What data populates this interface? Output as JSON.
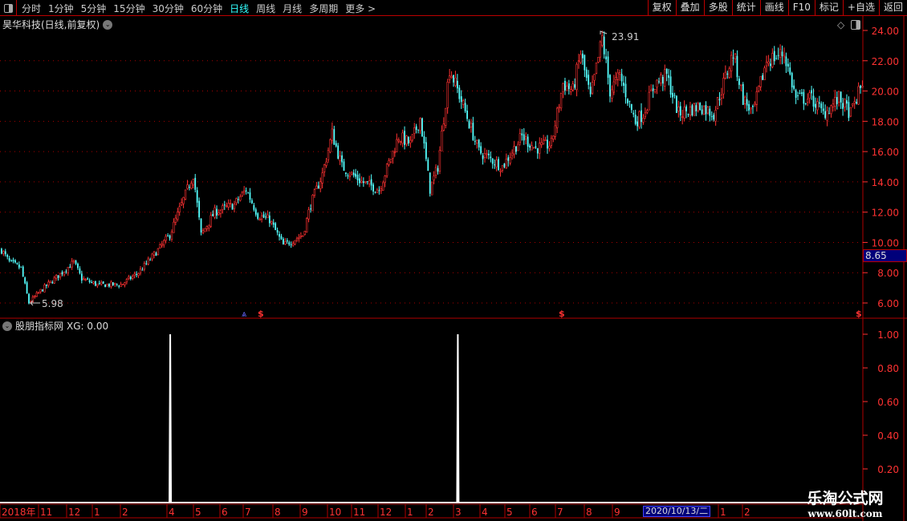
{
  "toolbar": {
    "periods": [
      "分时",
      "1分钟",
      "5分钟",
      "15分钟",
      "30分钟",
      "60分钟",
      "日线",
      "周线",
      "月线",
      "多周期",
      "更多 >"
    ],
    "active_period": "日线",
    "buttons": [
      "复权",
      "叠加",
      "多股",
      "统计",
      "画线",
      "F10",
      "标记",
      "+自选",
      "返回"
    ]
  },
  "header": {
    "title": "昊华科技(日线,前复权)"
  },
  "indicator": {
    "name": "股朋指标网",
    "value_label": "XG: 0.00"
  },
  "watermark": {
    "name": "乐淘公式网",
    "url": "www.60lt.com"
  },
  "cursor_date": "2020/10/13/二",
  "current_price": "8.65",
  "colors": {
    "up": "#ff3232",
    "down": "#54ffff",
    "axis": "#ff3232",
    "frame": "#b00000",
    "xg_line": "#ffffff",
    "highlight": "#00007a"
  },
  "chart_data": [
    {
      "type": "candlestick",
      "title": "昊华科技(日线,前复权)",
      "y_ticks": [
        "24.00",
        "22.00",
        "20.00",
        "18.00",
        "16.00",
        "14.00",
        "12.00",
        "10.00",
        "8.00",
        "6.00"
      ],
      "ylim": [
        6,
        24
      ],
      "grid": true,
      "x_ticks": [
        "2018年",
        "11",
        "12",
        "1",
        "2",
        "4",
        "5",
        "6",
        "7",
        "8",
        "9",
        "10",
        "11",
        "12",
        "1",
        "2",
        "3",
        "4",
        "5",
        "6",
        "7",
        "8",
        "9",
        "2020/10/13/二",
        "1",
        "2"
      ],
      "approx_price_path": [
        [
          0,
          9.5
        ],
        [
          4,
          8.7
        ],
        [
          10,
          8.3
        ],
        [
          14,
          6.0
        ],
        [
          20,
          6.8
        ],
        [
          29,
          7.8
        ],
        [
          37,
          8.7
        ],
        [
          41,
          7.6
        ],
        [
          49,
          7.2
        ],
        [
          61,
          7.2
        ],
        [
          70,
          8.0
        ],
        [
          80,
          9.5
        ],
        [
          86,
          10.5
        ],
        [
          92,
          12.5
        ],
        [
          98,
          14.5
        ],
        [
          102,
          10.5
        ],
        [
          109,
          12.0
        ],
        [
          119,
          12.5
        ],
        [
          125,
          13.5
        ],
        [
          131,
          11.8
        ],
        [
          137,
          11.5
        ],
        [
          144,
          9.8
        ],
        [
          154,
          10.5
        ],
        [
          158,
          12.5
        ],
        [
          164,
          14.5
        ],
        [
          169,
          17.2
        ],
        [
          174,
          15
        ],
        [
          184,
          14
        ],
        [
          193,
          13.5
        ],
        [
          203,
          17
        ],
        [
          209,
          16.5
        ],
        [
          214,
          18.2
        ],
        [
          219,
          13.5
        ],
        [
          223,
          15
        ],
        [
          229,
          21.5
        ],
        [
          236,
          19
        ],
        [
          244,
          16
        ],
        [
          256,
          15
        ],
        [
          266,
          17
        ],
        [
          273,
          16.2
        ],
        [
          281,
          16.5
        ],
        [
          287,
          20.5
        ],
        [
          292,
          20
        ],
        [
          296,
          22.5
        ],
        [
          301,
          19.5
        ],
        [
          307,
          23.5
        ],
        [
          311,
          20
        ],
        [
          316,
          21
        ],
        [
          324,
          18
        ],
        [
          328,
          18.5
        ],
        [
          334,
          20.5
        ],
        [
          340,
          21
        ],
        [
          346,
          18.5
        ],
        [
          357,
          19
        ],
        [
          364,
          18.5
        ],
        [
          374,
          22.5
        ],
        [
          379,
          19.5
        ],
        [
          384,
          18.5
        ],
        [
          391,
          22
        ],
        [
          400,
          22.5
        ],
        [
          406,
          19.5
        ],
        [
          414,
          19.5
        ],
        [
          420,
          18.5
        ],
        [
          428,
          19.5
        ],
        [
          434,
          18.5
        ],
        [
          440,
          20.5
        ]
      ],
      "annotations": [
        {
          "label": "23.91",
          "type": "high"
        },
        {
          "label": "5.98",
          "type": "low"
        }
      ]
    },
    {
      "type": "line",
      "series": [
        {
          "name": "XG",
          "spikes_at_bar": [
            87,
            234
          ],
          "spike_value": 1.0,
          "base_value": 0
        }
      ],
      "y_ticks": [
        "1.00",
        "0.80",
        "0.60",
        "0.40",
        "0.20"
      ],
      "ylim": [
        0,
        1.05
      ]
    }
  ]
}
